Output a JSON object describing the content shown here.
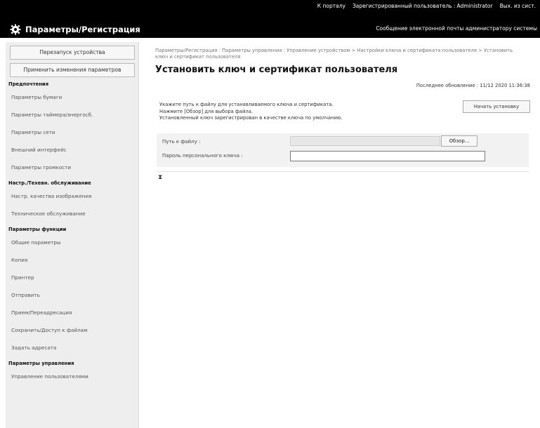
{
  "header": {
    "links": [
      "К порталу",
      "Зарегистрированный пользователь : ",
      "Administrator",
      "Вых. из сист."
    ],
    "app_title": "Параметры/Регистрация",
    "email_link": "Сообщение электронной почты администратору системы"
  },
  "sidebar": {
    "buttons": [
      "Перезапуск устройства",
      "Применить изменения параметров"
    ],
    "sections": [
      {
        "title": "Предпочтения",
        "items": [
          "Параметры бумаги",
          "Параметры таймера/энергосб.",
          "Параметры сети",
          "Внешний интерфейс",
          "Параметры громкости"
        ]
      },
      {
        "title": "Настр./Техевн. обслуживание",
        "items": [
          "Настр. качества изображения",
          "Техническое обслуживание"
        ]
      },
      {
        "title": "Параметры функции",
        "items": [
          "Общие параметры",
          "Копия",
          "Принтер",
          "Отправить",
          "Прием/Переадресация",
          "Сохранить/Доступ к файлам",
          "Задать адресата"
        ]
      },
      {
        "title": "Параметры управления",
        "items": [
          "Управление пользователями"
        ]
      }
    ]
  },
  "main": {
    "breadcrumb": "Параметры/Регистрация : Параметры управления : Управление устройством > Настройки ключа и сертификата пользователя > Установить ключ и сертификат пользователя",
    "title": "Установить ключ и сертификат пользователя",
    "updated": "Последнее обновление : 11/12 2020 11:36:38",
    "desc_lines": [
      "Укажите путь к файлу для устанавливаемого ключа и сертификата.",
      "Нажмите [Обзор] для выбора файла.",
      "Установленный ключ зарегистрирован в качестве ключа по умолчанию."
    ],
    "start_button": "Начать установку",
    "file_label": "Путь к файлу :",
    "browse_button": "Обзор...",
    "password_label": "Пароль персонального ключа :",
    "file_value": "",
    "password_value": "",
    "to_top": "⧗"
  },
  "colors": {
    "header_bg": "#000000",
    "sidebar_bg": "#eeeeee",
    "form_bg": "#f2f2f2"
  },
  "icons": {
    "app": "gear-icon",
    "to_top": "to-top-icon"
  }
}
